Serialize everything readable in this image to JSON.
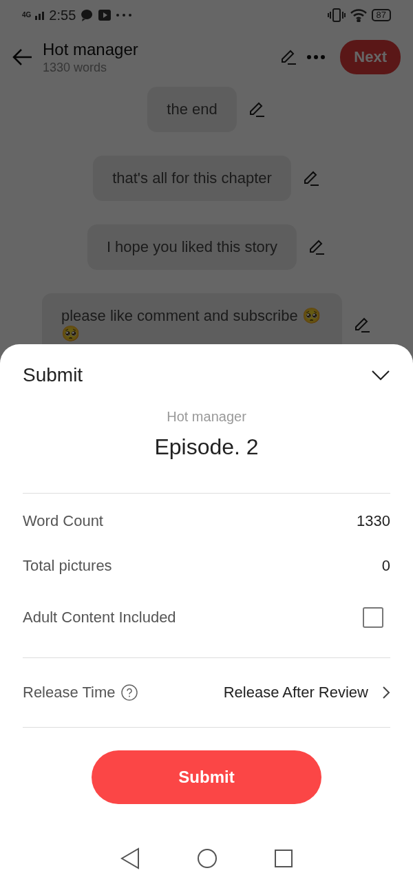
{
  "status_bar": {
    "network": "4G",
    "time": "2:55",
    "battery": "87"
  },
  "header": {
    "title": "Hot manager",
    "subtitle": "1330 words",
    "next_button": "Next"
  },
  "messages": [
    {
      "text": "the end"
    },
    {
      "text": "that's all for this chapter"
    },
    {
      "text": "I hope you liked this story"
    },
    {
      "text": "please like comment and subscribe 🥺🥺"
    }
  ],
  "sheet": {
    "title": "Submit",
    "expanded": true,
    "book_title": "Hot manager",
    "episode": "Episode. 2",
    "stats": [
      {
        "kind": "value",
        "label": "Word Count",
        "value": "1330"
      },
      {
        "kind": "value",
        "label": "Total pictures",
        "value": "0"
      },
      {
        "kind": "checkbox",
        "label": "Adult Content Included",
        "checked": false
      }
    ],
    "release": {
      "label": "Release Time",
      "value": "Release After Review"
    },
    "submit_button": "Submit"
  }
}
